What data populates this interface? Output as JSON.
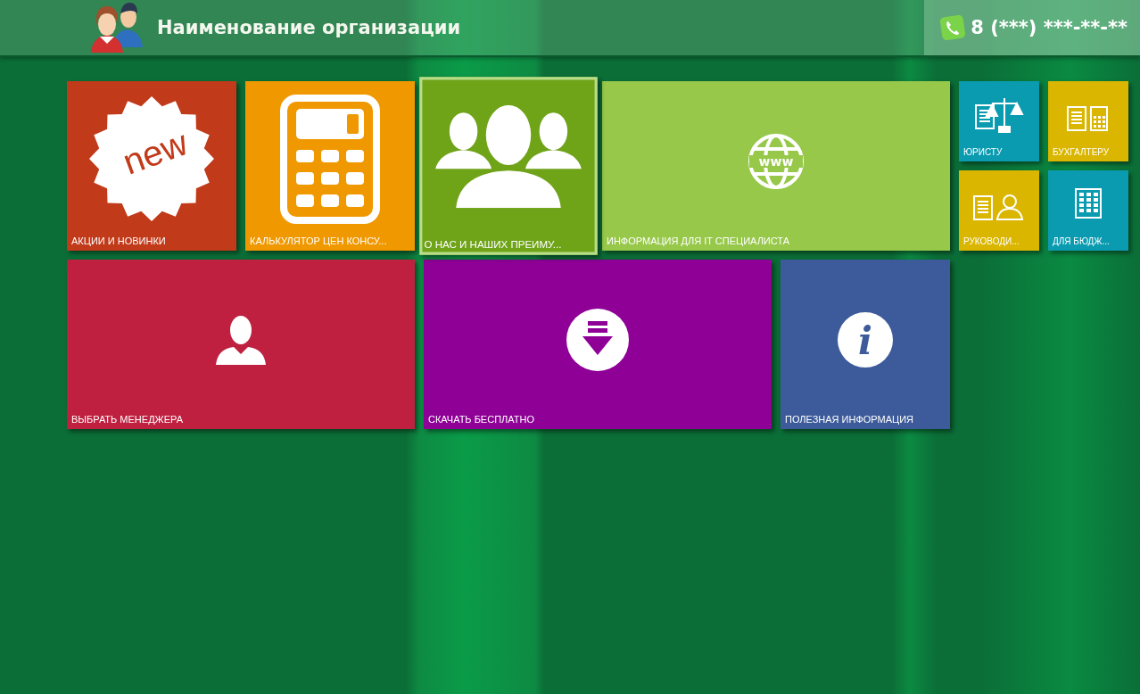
{
  "header": {
    "title": "Наименование организации",
    "phone": "8 (***) ***-**-**"
  },
  "tiles": [
    {
      "kind": "medium",
      "label": "АКЦИИ И НОВИНКИ",
      "color": "#c13a1a",
      "selected": false,
      "badge": "new"
    },
    {
      "kind": "medium",
      "label": "КАЛЬКУЛЯТОР ЦЕН КОНСУ...",
      "color": "#f09800",
      "selected": false
    },
    {
      "kind": "medium",
      "label": "О НАС И НАШИХ ПРЕИМУ...",
      "color": "#6fa318",
      "selected": true
    },
    {
      "kind": "wide",
      "label": "ИНФОРМАЦИЯ ДЛЯ IT СПЕЦИАЛИСТА",
      "color": "#97c84a",
      "selected": false,
      "icon_text": "www"
    },
    {
      "kind": "small",
      "label": "ЮРИСТУ",
      "color": "#0a9bb0",
      "selected": false
    },
    {
      "kind": "small",
      "label": "БУХГАЛТЕРУ",
      "color": "#dab600",
      "selected": false
    },
    {
      "kind": "small",
      "label": "РУКОВОДИ...",
      "color": "#dab600",
      "selected": false
    },
    {
      "kind": "small",
      "label": "ДЛЯ БЮДЖ...",
      "color": "#0a9bb0",
      "selected": false
    },
    {
      "kind": "wide",
      "label": "ВЫБРАТЬ МЕНЕДЖЕРА",
      "color": "#bf2040",
      "selected": false
    },
    {
      "kind": "wide",
      "label": "СКАЧАТЬ БЕСПЛАТНО",
      "color": "#8e0096",
      "selected": false
    },
    {
      "kind": "medium",
      "label": "ПОЛЕЗНАЯ ИНФОРМАЦИЯ",
      "color": "#3d5b9a",
      "selected": false,
      "icon_text": "i"
    }
  ]
}
